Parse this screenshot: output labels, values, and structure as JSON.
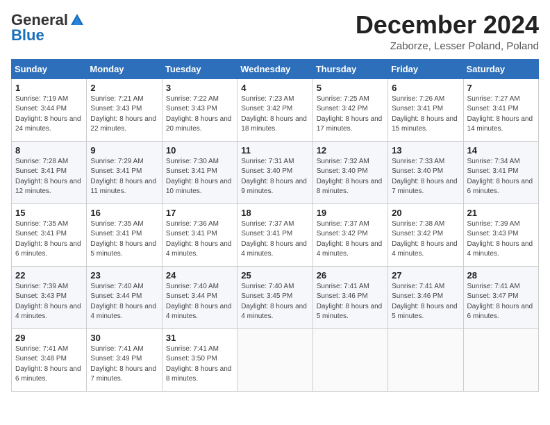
{
  "logo": {
    "line1": "General",
    "line2": "Blue"
  },
  "title": "December 2024",
  "location": "Zaborze, Lesser Poland, Poland",
  "headers": [
    "Sunday",
    "Monday",
    "Tuesday",
    "Wednesday",
    "Thursday",
    "Friday",
    "Saturday"
  ],
  "weeks": [
    [
      {
        "day": "1",
        "sunrise": "Sunrise: 7:19 AM",
        "sunset": "Sunset: 3:44 PM",
        "daylight": "Daylight: 8 hours and 24 minutes."
      },
      {
        "day": "2",
        "sunrise": "Sunrise: 7:21 AM",
        "sunset": "Sunset: 3:43 PM",
        "daylight": "Daylight: 8 hours and 22 minutes."
      },
      {
        "day": "3",
        "sunrise": "Sunrise: 7:22 AM",
        "sunset": "Sunset: 3:43 PM",
        "daylight": "Daylight: 8 hours and 20 minutes."
      },
      {
        "day": "4",
        "sunrise": "Sunrise: 7:23 AM",
        "sunset": "Sunset: 3:42 PM",
        "daylight": "Daylight: 8 hours and 18 minutes."
      },
      {
        "day": "5",
        "sunrise": "Sunrise: 7:25 AM",
        "sunset": "Sunset: 3:42 PM",
        "daylight": "Daylight: 8 hours and 17 minutes."
      },
      {
        "day": "6",
        "sunrise": "Sunrise: 7:26 AM",
        "sunset": "Sunset: 3:41 PM",
        "daylight": "Daylight: 8 hours and 15 minutes."
      },
      {
        "day": "7",
        "sunrise": "Sunrise: 7:27 AM",
        "sunset": "Sunset: 3:41 PM",
        "daylight": "Daylight: 8 hours and 14 minutes."
      }
    ],
    [
      {
        "day": "8",
        "sunrise": "Sunrise: 7:28 AM",
        "sunset": "Sunset: 3:41 PM",
        "daylight": "Daylight: 8 hours and 12 minutes."
      },
      {
        "day": "9",
        "sunrise": "Sunrise: 7:29 AM",
        "sunset": "Sunset: 3:41 PM",
        "daylight": "Daylight: 8 hours and 11 minutes."
      },
      {
        "day": "10",
        "sunrise": "Sunrise: 7:30 AM",
        "sunset": "Sunset: 3:41 PM",
        "daylight": "Daylight: 8 hours and 10 minutes."
      },
      {
        "day": "11",
        "sunrise": "Sunrise: 7:31 AM",
        "sunset": "Sunset: 3:40 PM",
        "daylight": "Daylight: 8 hours and 9 minutes."
      },
      {
        "day": "12",
        "sunrise": "Sunrise: 7:32 AM",
        "sunset": "Sunset: 3:40 PM",
        "daylight": "Daylight: 8 hours and 8 minutes."
      },
      {
        "day": "13",
        "sunrise": "Sunrise: 7:33 AM",
        "sunset": "Sunset: 3:40 PM",
        "daylight": "Daylight: 8 hours and 7 minutes."
      },
      {
        "day": "14",
        "sunrise": "Sunrise: 7:34 AM",
        "sunset": "Sunset: 3:41 PM",
        "daylight": "Daylight: 8 hours and 6 minutes."
      }
    ],
    [
      {
        "day": "15",
        "sunrise": "Sunrise: 7:35 AM",
        "sunset": "Sunset: 3:41 PM",
        "daylight": "Daylight: 8 hours and 6 minutes."
      },
      {
        "day": "16",
        "sunrise": "Sunrise: 7:35 AM",
        "sunset": "Sunset: 3:41 PM",
        "daylight": "Daylight: 8 hours and 5 minutes."
      },
      {
        "day": "17",
        "sunrise": "Sunrise: 7:36 AM",
        "sunset": "Sunset: 3:41 PM",
        "daylight": "Daylight: 8 hours and 4 minutes."
      },
      {
        "day": "18",
        "sunrise": "Sunrise: 7:37 AM",
        "sunset": "Sunset: 3:41 PM",
        "daylight": "Daylight: 8 hours and 4 minutes."
      },
      {
        "day": "19",
        "sunrise": "Sunrise: 7:37 AM",
        "sunset": "Sunset: 3:42 PM",
        "daylight": "Daylight: 8 hours and 4 minutes."
      },
      {
        "day": "20",
        "sunrise": "Sunrise: 7:38 AM",
        "sunset": "Sunset: 3:42 PM",
        "daylight": "Daylight: 8 hours and 4 minutes."
      },
      {
        "day": "21",
        "sunrise": "Sunrise: 7:39 AM",
        "sunset": "Sunset: 3:43 PM",
        "daylight": "Daylight: 8 hours and 4 minutes."
      }
    ],
    [
      {
        "day": "22",
        "sunrise": "Sunrise: 7:39 AM",
        "sunset": "Sunset: 3:43 PM",
        "daylight": "Daylight: 8 hours and 4 minutes."
      },
      {
        "day": "23",
        "sunrise": "Sunrise: 7:40 AM",
        "sunset": "Sunset: 3:44 PM",
        "daylight": "Daylight: 8 hours and 4 minutes."
      },
      {
        "day": "24",
        "sunrise": "Sunrise: 7:40 AM",
        "sunset": "Sunset: 3:44 PM",
        "daylight": "Daylight: 8 hours and 4 minutes."
      },
      {
        "day": "25",
        "sunrise": "Sunrise: 7:40 AM",
        "sunset": "Sunset: 3:45 PM",
        "daylight": "Daylight: 8 hours and 4 minutes."
      },
      {
        "day": "26",
        "sunrise": "Sunrise: 7:41 AM",
        "sunset": "Sunset: 3:46 PM",
        "daylight": "Daylight: 8 hours and 5 minutes."
      },
      {
        "day": "27",
        "sunrise": "Sunrise: 7:41 AM",
        "sunset": "Sunset: 3:46 PM",
        "daylight": "Daylight: 8 hours and 5 minutes."
      },
      {
        "day": "28",
        "sunrise": "Sunrise: 7:41 AM",
        "sunset": "Sunset: 3:47 PM",
        "daylight": "Daylight: 8 hours and 6 minutes."
      }
    ],
    [
      {
        "day": "29",
        "sunrise": "Sunrise: 7:41 AM",
        "sunset": "Sunset: 3:48 PM",
        "daylight": "Daylight: 8 hours and 6 minutes."
      },
      {
        "day": "30",
        "sunrise": "Sunrise: 7:41 AM",
        "sunset": "Sunset: 3:49 PM",
        "daylight": "Daylight: 8 hours and 7 minutes."
      },
      {
        "day": "31",
        "sunrise": "Sunrise: 7:41 AM",
        "sunset": "Sunset: 3:50 PM",
        "daylight": "Daylight: 8 hours and 8 minutes."
      },
      null,
      null,
      null,
      null
    ]
  ]
}
